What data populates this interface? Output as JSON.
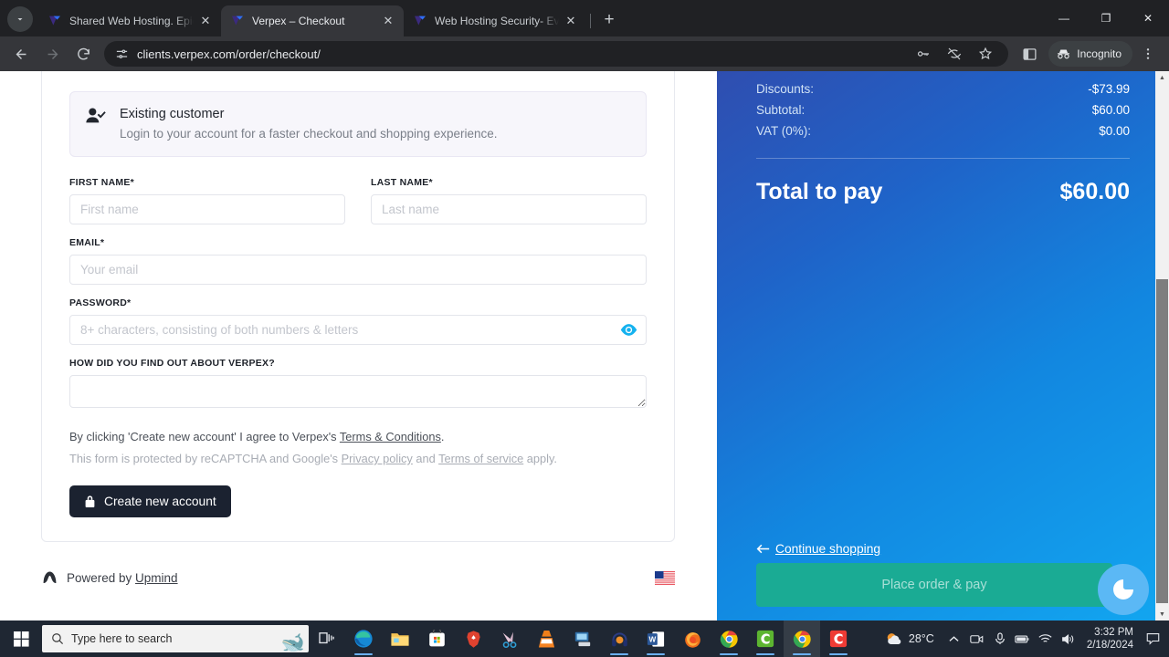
{
  "browser": {
    "tabs": [
      {
        "title": "Shared Web Hosting. Epic Sales",
        "favicon": "verpex-icon",
        "active": false
      },
      {
        "title": "Verpex – Checkout",
        "favicon": "verpex-icon",
        "active": true
      },
      {
        "title": "Web Hosting Security- Everything",
        "favicon": "verpex-icon",
        "active": false
      }
    ],
    "new_tab_label": "+",
    "close_label": "✕",
    "url": "clients.verpex.com/order/checkout/",
    "incognito_label": "Incognito",
    "window_controls": {
      "minimize": "—",
      "maximize": "❐",
      "close": "✕"
    }
  },
  "existing_customer": {
    "title": "Existing customer",
    "subtitle": "Login to your account for a faster checkout and shopping experience."
  },
  "form": {
    "first_name": {
      "label": "FIRST NAME*",
      "placeholder": "First name",
      "value": ""
    },
    "last_name": {
      "label": "LAST NAME*",
      "placeholder": "Last name",
      "value": ""
    },
    "email": {
      "label": "EMAIL*",
      "placeholder": "Your email",
      "value": ""
    },
    "password": {
      "label": "PASSWORD*",
      "placeholder": "8+ characters, consisting of both numbers & letters",
      "value": ""
    },
    "referral": {
      "label": "HOW DID YOU FIND OUT ABOUT VERPEX?",
      "placeholder": "",
      "value": ""
    },
    "legal_line1_pre": "By clicking 'Create new account' I agree to Verpex's ",
    "legal_line1_link": "Terms & Conditions",
    "legal_line1_post": ".",
    "legal_line2_pre": "This form is protected by reCAPTCHA and Google's ",
    "legal_line2_link1": "Privacy policy",
    "legal_line2_mid": " and ",
    "legal_line2_link2": "Terms of service",
    "legal_line2_post": " apply.",
    "submit_label": "Create new account"
  },
  "footer": {
    "powered_pre": "Powered by ",
    "powered_link": "Upmind",
    "locale_flag": "us-flag"
  },
  "summary": {
    "rows": [
      {
        "label": "Discounts:",
        "value": "-$73.99"
      },
      {
        "label": "Subtotal:",
        "value": "$60.00"
      },
      {
        "label": "VAT (0%):",
        "value": "$0.00"
      }
    ],
    "total_label": "Total to pay",
    "total_value": "$60.00",
    "continue_label": "Continue shopping",
    "place_order_label": "Place order & pay",
    "accent_teal": "#1aab94",
    "chat_bubble_color": "#5bb8f5"
  },
  "taskbar": {
    "search_placeholder": "Type here to search",
    "weather_temp": "28°C",
    "time": "3:32 PM",
    "date": "2/18/2024",
    "apps": [
      "task-view-icon",
      "edge-icon",
      "file-explorer-icon",
      "microsoft-store-icon",
      "brave-icon",
      "snipping-tool-icon",
      "vlc-icon",
      "remote-desktop-icon",
      "headphones-icon",
      "word-icon",
      "firefox-icon",
      "chrome-icon",
      "camtasia-icon",
      "chrome-icon",
      "camtasia-recorder-icon"
    ]
  }
}
